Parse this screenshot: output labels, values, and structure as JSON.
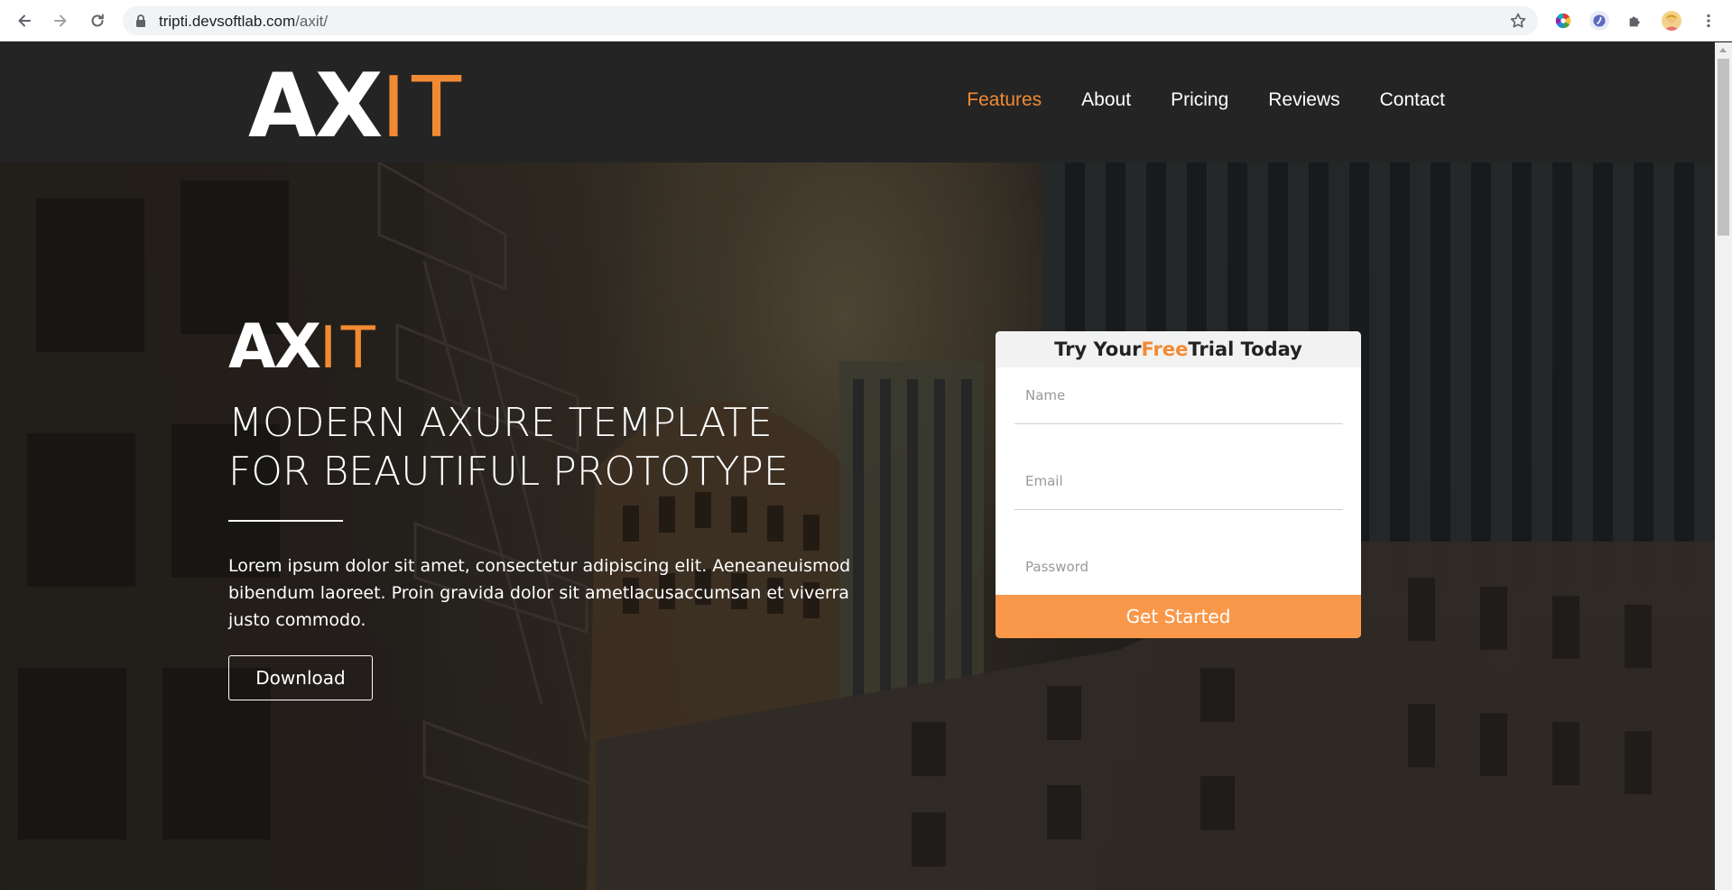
{
  "browser": {
    "url_host": "tripti.devsoftlab.com",
    "url_path": "/axit/",
    "icons": [
      "back-arrow-icon",
      "forward-arrow-icon",
      "reload-icon",
      "lock-icon",
      "star-icon",
      "color-wheel-extension-icon",
      "shield-extension-icon",
      "puzzle-extension-icon",
      "profile-avatar",
      "kebab-menu-icon"
    ]
  },
  "header": {
    "logo_ax": "AX",
    "logo_it": "IT",
    "nav": [
      {
        "label": "Features",
        "active": true
      },
      {
        "label": "About",
        "active": false
      },
      {
        "label": "Pricing",
        "active": false
      },
      {
        "label": "Reviews",
        "active": false
      },
      {
        "label": "Contact",
        "active": false
      }
    ]
  },
  "hero": {
    "title_ax": "AX",
    "title_it": "IT",
    "heading_line1": "MODERN AXURE TEMPLATE",
    "heading_line2": "FOR BEAUTIFUL PROTOTYPE",
    "copy": "Lorem ipsum dolor sit amet, consectetur adipiscing elit. Aeneaneuismod bibendum laoreet. Proin gravida dolor sit ametlacusaccumsan et viverra justo commodo.",
    "download_label": "Download"
  },
  "trial_form": {
    "heading_pre": "Try Your ",
    "heading_free": "Free",
    "heading_post": "Trial Today",
    "name_placeholder": "Name",
    "email_placeholder": "Email",
    "password_placeholder": "Password",
    "submit_label": "Get Started"
  },
  "colors": {
    "accent": "#f18a33",
    "button_orange": "#f9984a",
    "header_bg": "#242424"
  }
}
